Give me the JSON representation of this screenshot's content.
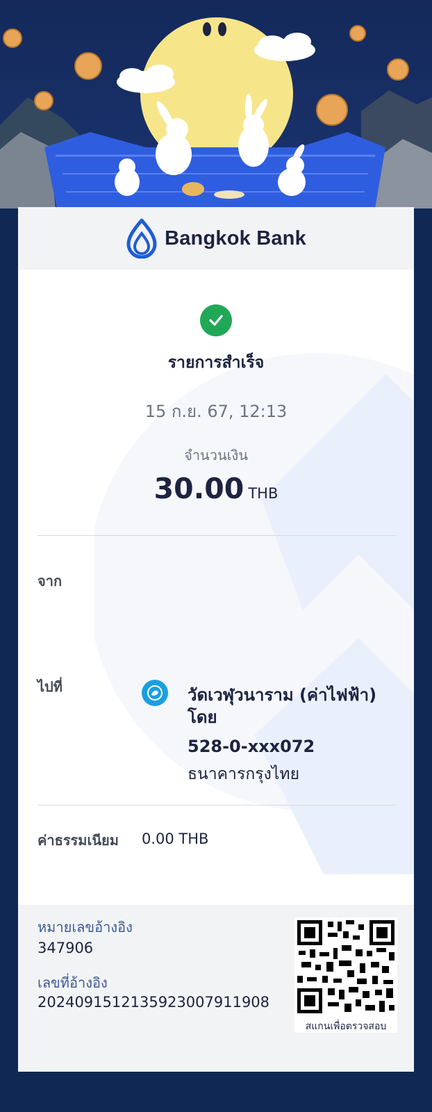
{
  "brand": {
    "name": "Bangkok Bank"
  },
  "status": {
    "title": "รายการสำเร็จ",
    "datetime": "15 ก.ย. 67, 12:13"
  },
  "amount": {
    "label": "จำนวนเงิน",
    "value": "30.00",
    "currency": "THB"
  },
  "from": {
    "label": "จาก"
  },
  "to": {
    "label": "ไปที่",
    "name": "วัดเวฬุวนาราม (ค่าไฟฟ้า) โดย",
    "account": "528-0-xxx072",
    "bank": "ธนาคารกรุงไทย",
    "icon": "ktb-bank-logo-icon"
  },
  "fee": {
    "label": "ค่าธรรมเนียม",
    "value": "0.00 THB"
  },
  "reference": {
    "ref_label": "หมายเลขอ้างอิง",
    "ref_value": "347906",
    "txn_label": "เลขที่อ้างอิง",
    "txn_value": "20240915121359230079119​08",
    "qr_caption": "สแกนเพื่อตรวจสอบ"
  },
  "colors": {
    "brand_blue": "#1f5cd6",
    "success_green": "#21a857",
    "navy_background": "#0f2854",
    "ktb_blue": "#1b9fe0"
  }
}
